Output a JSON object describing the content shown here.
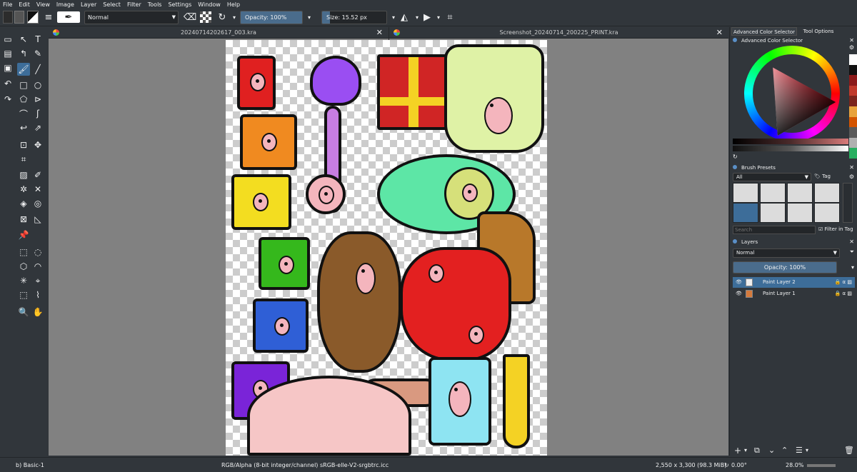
{
  "menu": [
    "File",
    "Edit",
    "View",
    "Image",
    "Layer",
    "Select",
    "Filter",
    "Tools",
    "Settings",
    "Window",
    "Help"
  ],
  "toolbar": {
    "blend_mode": "Normal",
    "opacity_label": "Opacity: 100%",
    "opacity_value": 1.0,
    "size_label": "Size: 15.52 px",
    "size_fill": 0.12
  },
  "tabs": [
    {
      "title": "20240714202617_003.kra"
    },
    {
      "title": "Screenshot_20240714_200225_PRINT.kra"
    }
  ],
  "dock": {
    "tab_color_selector": "Advanced Color Selector",
    "tab_tool_options": "Tool Options",
    "color_selector_title": "Advanced Color Selector",
    "brush_presets_title": "Brush Presets",
    "brush_filter": "All",
    "tag_label": "Tag",
    "search_placeholder": "Search",
    "filter_in_tag": "Filter in Tag",
    "layers_title": "Layers",
    "layer_blend": "Normal",
    "layer_opacity": "Opacity: 100%",
    "layers": [
      {
        "name": "Paint Layer 2",
        "selected": true
      },
      {
        "name": "Paint Layer 1",
        "selected": false
      }
    ],
    "recent_colors": [
      "#ffffff",
      "#111111",
      "#8b1a1a",
      "#c0392b",
      "#7b241c",
      "#e8a33c",
      "#d35400",
      "#5a5a5a",
      "#b0b0b0",
      "#27ae60"
    ],
    "accent_color": "#3d6d99"
  },
  "status": {
    "brush": "b) Basic-1",
    "color_space": "RGB/Alpha (8-bit integer/channel)  sRGB-elle-V2-srgbtrc.icc",
    "dimensions": "2,550 x 3,300 (98.3 MiB)",
    "rotation": "0.00°",
    "zoom": "28.0%"
  }
}
